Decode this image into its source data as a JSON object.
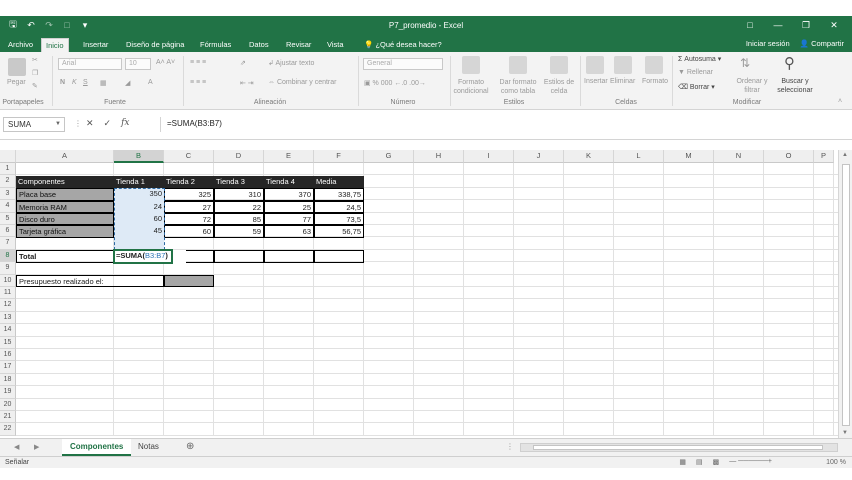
{
  "window": {
    "title": "P7_promedio - Excel",
    "colors": {
      "accent": "#217346",
      "header_fill": "#262626",
      "label_fill": "#a6a6a6",
      "reference": "#2e75b6"
    }
  },
  "ribbon_tabs": [
    "Archivo",
    "Inicio",
    "Insertar",
    "Diseño de página",
    "Fórmulas",
    "Datos",
    "Revisar",
    "Vista"
  ],
  "active_tab": "Inicio",
  "tell_me": "¿Qué desea hacer?",
  "account": {
    "signin": "Iniciar sesión",
    "share": "Compartir"
  },
  "ribbon": {
    "clipboard": {
      "paste": "Pegar",
      "label": "Portapapeles"
    },
    "font": {
      "name": "Arial",
      "size": "10",
      "label": "Fuente"
    },
    "alignment": {
      "wrap": "Ajustar texto",
      "merge": "Combinar y centrar",
      "label": "Alineación"
    },
    "number": {
      "format": "General",
      "label": "Número"
    },
    "styles": {
      "cond": "Formato condicional",
      "table": "Dar formato como tabla",
      "cell": "Estilos de celda",
      "label": "Estilos"
    },
    "cells": {
      "insert": "Insertar",
      "delete": "Eliminar",
      "format": "Formato",
      "label": "Celdas"
    },
    "editing": {
      "autosum": "Autosuma",
      "fill": "Rellenar",
      "clear": "Borrar",
      "sort": "Ordenar y filtrar",
      "find": "Buscar y seleccionar",
      "label": "Modificar"
    }
  },
  "formula_bar": {
    "name_box": "SUMA",
    "cancel": "✕",
    "enter": "✓",
    "fx": "fx",
    "formula": "=SUMA(B3:B7)"
  },
  "columns": [
    "A",
    "B",
    "C",
    "D",
    "E",
    "F",
    "G",
    "H",
    "I",
    "J",
    "K",
    "L",
    "M",
    "N",
    "O",
    "P"
  ],
  "rows": [
    "1",
    "2",
    "3",
    "4",
    "5",
    "6",
    "7",
    "8",
    "9",
    "10",
    "11",
    "12",
    "13",
    "14",
    "15",
    "16",
    "17",
    "18",
    "19",
    "20",
    "21",
    "22"
  ],
  "table": {
    "headers": [
      "Componentes",
      "Tienda 1",
      "Tienda 2",
      "Tienda 3",
      "Tienda 4",
      "Media"
    ],
    "data": [
      [
        "Placa base",
        "350",
        "325",
        "310",
        "370",
        "338,75"
      ],
      [
        "Memoria RAM",
        "24",
        "27",
        "22",
        "25",
        "24,5"
      ],
      [
        "Disco duro",
        "60",
        "72",
        "85",
        "77",
        "73,5"
      ],
      [
        "Tarjeta gráfica",
        "45",
        "60",
        "59",
        "63",
        "56,75"
      ]
    ],
    "total_label": "Total",
    "total_formula_prefix": "=SUMA(",
    "total_formula_ref": "B3:B7",
    "total_formula_suffix": ")",
    "budget_label": "Presupuesto realizado el:"
  },
  "sheets": [
    "Componentes",
    "Notas"
  ],
  "active_sheet": "Componentes",
  "status": {
    "mode": "Señalar",
    "zoom": "100 %"
  }
}
